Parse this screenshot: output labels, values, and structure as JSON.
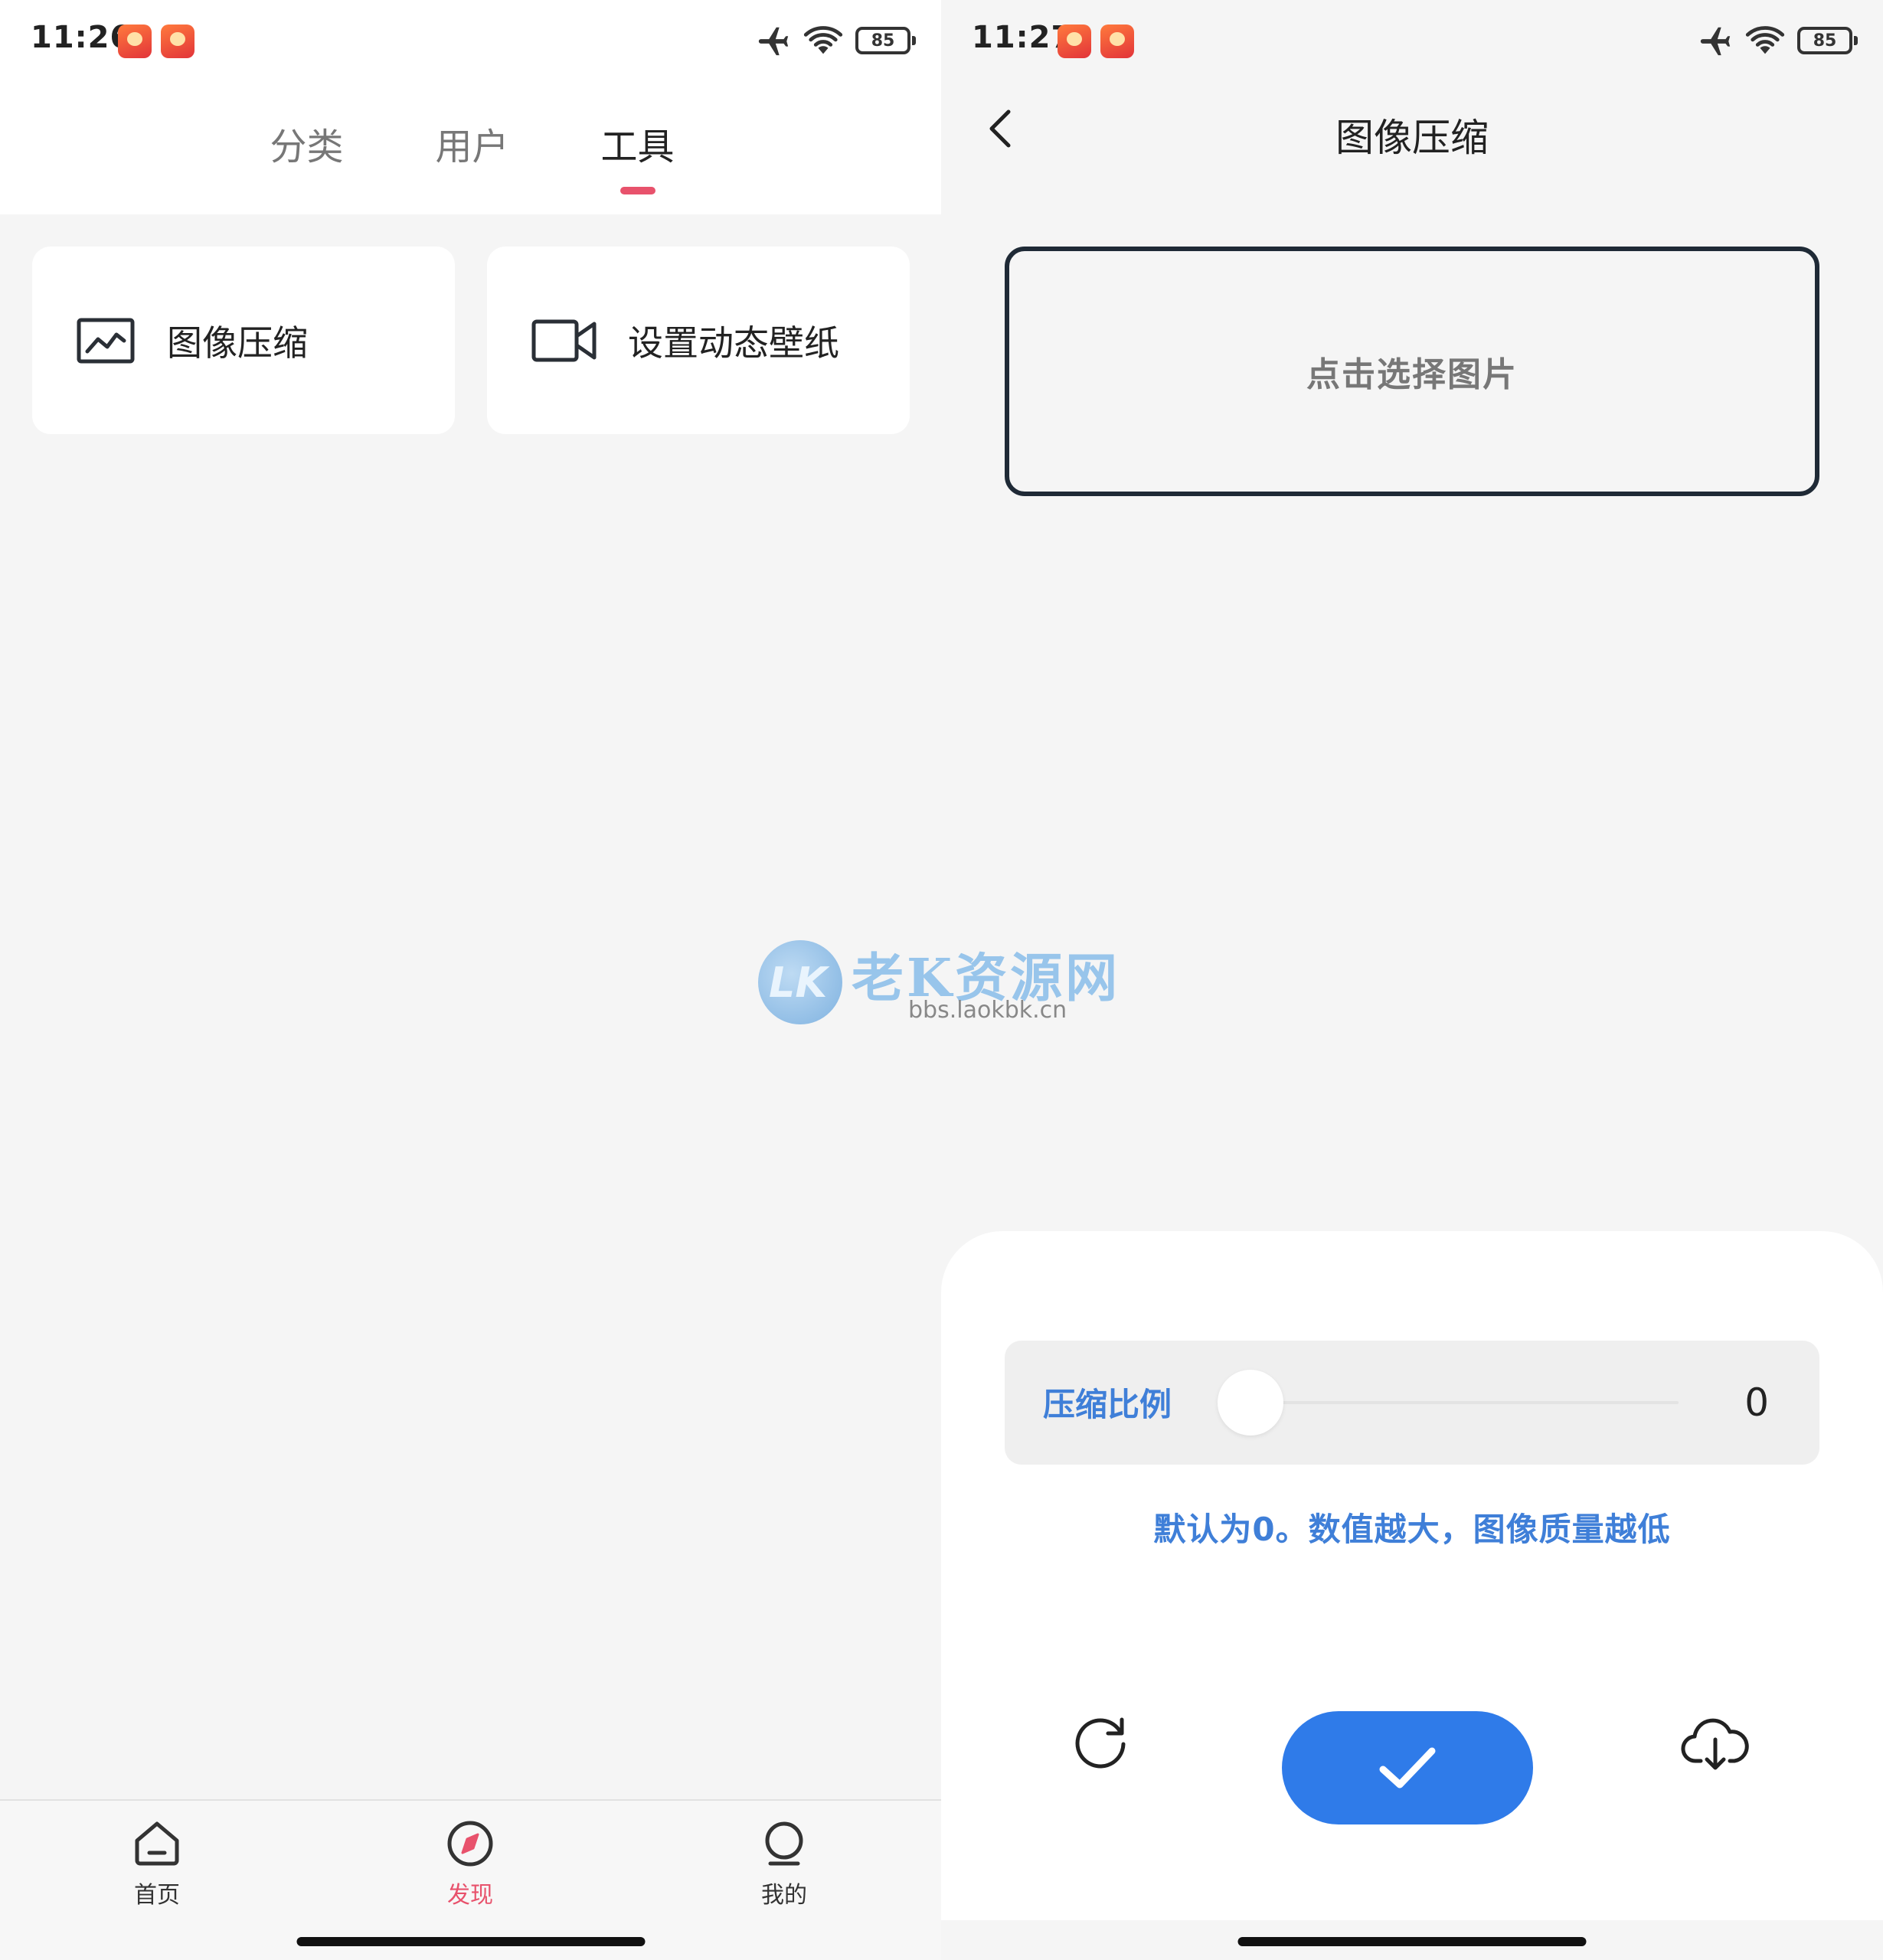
{
  "left": {
    "status": {
      "time": "11:26",
      "battery": "85"
    },
    "tabs": [
      {
        "label": "分类"
      },
      {
        "label": "用户"
      },
      {
        "label": "工具"
      }
    ],
    "tools": [
      {
        "label": "图像压缩",
        "icon": "image-icon"
      },
      {
        "label": "设置动态壁纸",
        "icon": "video-camera-icon"
      }
    ],
    "nav": [
      {
        "label": "首页",
        "icon": "home-icon"
      },
      {
        "label": "发现",
        "icon": "compass-icon"
      },
      {
        "label": "我的",
        "icon": "user-icon"
      }
    ]
  },
  "right": {
    "status": {
      "time": "11:27",
      "battery": "85"
    },
    "title": "图像压缩",
    "picker_label": "点击选择图片",
    "slider": {
      "label": "压缩比例",
      "value": "0"
    },
    "hint": "默认为0。数值越大，图像质量越低"
  },
  "watermark": {
    "logo": "LK",
    "title": "老K资源网",
    "url": "bbs.laokbk.cn"
  },
  "colors": {
    "accent_pink": "#e8526c",
    "accent_blue": "#2f7be9",
    "hint_blue": "#3f7fd8"
  }
}
